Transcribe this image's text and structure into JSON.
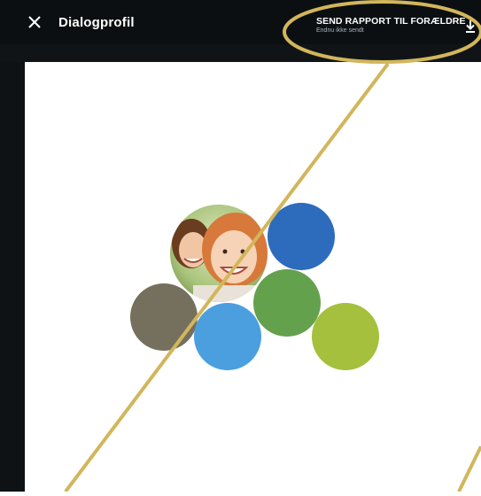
{
  "header": {
    "title": "Dialogprofil",
    "send_report_label": "SEND RAPPORT TIL FORÆLDRE",
    "send_status": "Endnu ikke sendt"
  },
  "icons": {
    "close": "close-icon",
    "download": "download-icon",
    "photo": "children-photo"
  },
  "profile_circles": [
    {
      "name": "photo-circle",
      "content": "children-photo"
    },
    {
      "name": "dark-blue-circle",
      "color": "#2d6bbd"
    },
    {
      "name": "gray-circle",
      "color": "#75705e"
    },
    {
      "name": "green-circle",
      "color": "#64a14d"
    },
    {
      "name": "light-blue-circle",
      "color": "#4b9fdf"
    },
    {
      "name": "lime-circle",
      "color": "#a4c03d"
    }
  ],
  "annotation": {
    "color": "#d2b65b"
  }
}
